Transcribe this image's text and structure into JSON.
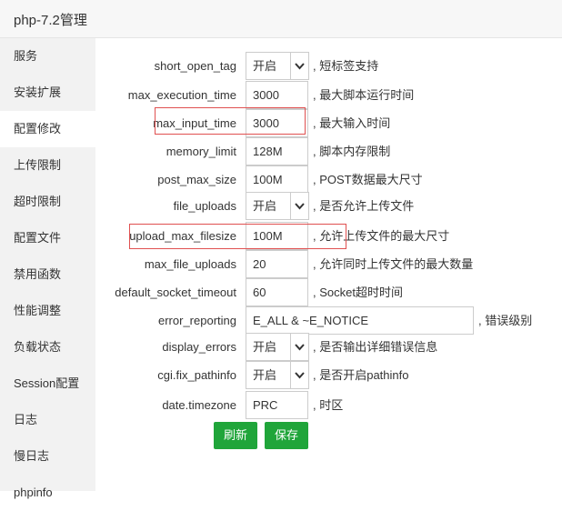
{
  "window": {
    "title": "php-7.2管理"
  },
  "sidebar": {
    "items": [
      {
        "label": "服务"
      },
      {
        "label": "安装扩展"
      },
      {
        "label": "配置修改"
      },
      {
        "label": "上传限制"
      },
      {
        "label": "超时限制"
      },
      {
        "label": "配置文件"
      },
      {
        "label": "禁用函数"
      },
      {
        "label": "性能调整"
      },
      {
        "label": "负载状态"
      },
      {
        "label": "Session配置"
      },
      {
        "label": "日志"
      },
      {
        "label": "慢日志"
      },
      {
        "label": "phpinfo"
      }
    ],
    "active_index": 2
  },
  "settings": [
    {
      "key": "short_open_tag",
      "type": "select",
      "value": "开启",
      "desc": ", 短标签支持"
    },
    {
      "key": "max_execution_time",
      "type": "input",
      "value": "3000",
      "desc": ", 最大脚本运行时间"
    },
    {
      "key": "max_input_time",
      "type": "input",
      "value": "3000",
      "desc": ", 最大输入时间",
      "highlighted": true
    },
    {
      "key": "memory_limit",
      "type": "input",
      "value": "128M",
      "desc": ", 脚本内存限制"
    },
    {
      "key": "post_max_size",
      "type": "input",
      "value": "100M",
      "desc": ", POST数据最大尺寸"
    },
    {
      "key": "file_uploads",
      "type": "select",
      "value": "开启",
      "desc": ", 是否允许上传文件"
    },
    {
      "key": "upload_max_filesize",
      "type": "input",
      "value": "100M",
      "desc": ", 允许上传文件的最大尺寸",
      "highlighted": true
    },
    {
      "key": "max_file_uploads",
      "type": "input",
      "value": "20",
      "desc": ", 允许同时上传文件的最大数量"
    },
    {
      "key": "default_socket_timeout",
      "type": "input",
      "value": "60",
      "desc": ", Socket超时时间"
    },
    {
      "key": "error_reporting",
      "type": "input-wide",
      "value": "E_ALL & ~E_NOTICE",
      "desc": ", 错误级别"
    },
    {
      "key": "display_errors",
      "type": "select",
      "value": "开启",
      "desc": ", 是否输出详细错误信息"
    },
    {
      "key": "cgi.fix_pathinfo",
      "type": "select",
      "value": "开启",
      "desc": ", 是否开启pathinfo"
    },
    {
      "key": "date.timezone",
      "type": "input",
      "value": "PRC",
      "desc": ", 时区"
    }
  ],
  "buttons": {
    "refresh": "刷新",
    "save": "保存"
  },
  "colors": {
    "accent_green": "#20a53a",
    "highlight_red": "#e05050",
    "sidebar_bg": "#f2f2f2"
  }
}
